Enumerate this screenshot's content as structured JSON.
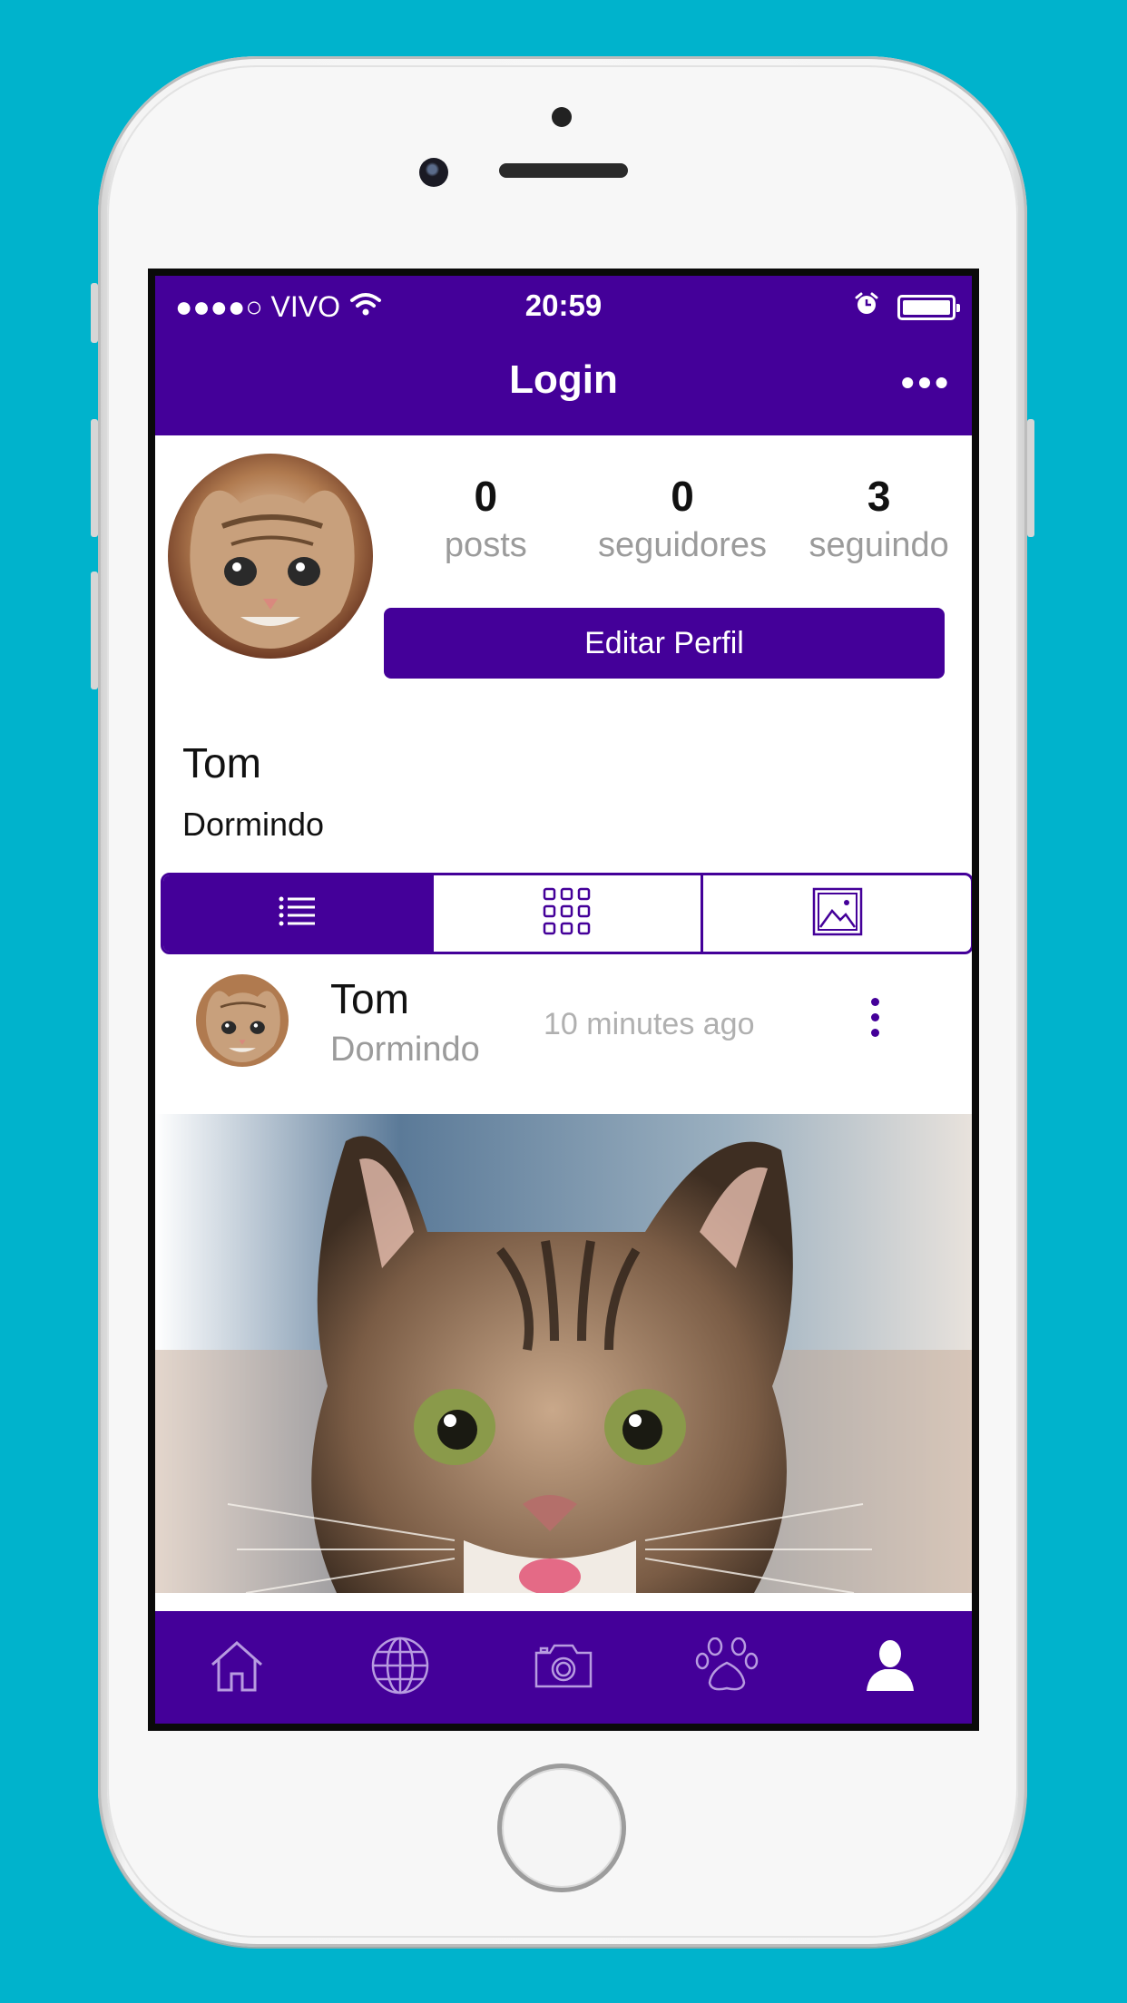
{
  "statusbar": {
    "carrier": "●●●●○ VIVO",
    "time": "20:59"
  },
  "navbar": {
    "title": "Login",
    "more_label": "•••"
  },
  "profile": {
    "stats": [
      {
        "value": "0",
        "label": "posts"
      },
      {
        "value": "0",
        "label": "seguidores"
      },
      {
        "value": "3",
        "label": "seguindo"
      }
    ],
    "edit_button": "Editar Perfil",
    "name": "Tom",
    "bio": "Dormindo"
  },
  "view_tabs": {
    "items": [
      {
        "icon": "list-icon",
        "active": true
      },
      {
        "icon": "grid-icon",
        "active": false
      },
      {
        "icon": "image-icon",
        "active": false
      }
    ]
  },
  "post": {
    "author": "Tom",
    "status": "Dormindo",
    "time": "10 minutes ago"
  },
  "tabbar": {
    "items": [
      {
        "icon": "home-icon",
        "active": false
      },
      {
        "icon": "globe-icon",
        "active": false
      },
      {
        "icon": "camera-icon",
        "active": false
      },
      {
        "icon": "paw-icon",
        "active": false
      },
      {
        "icon": "profile-icon",
        "active": true
      }
    ]
  },
  "colors": {
    "brand": "#440099",
    "background": "#00b3cc",
    "muted": "#9b9b9b"
  }
}
